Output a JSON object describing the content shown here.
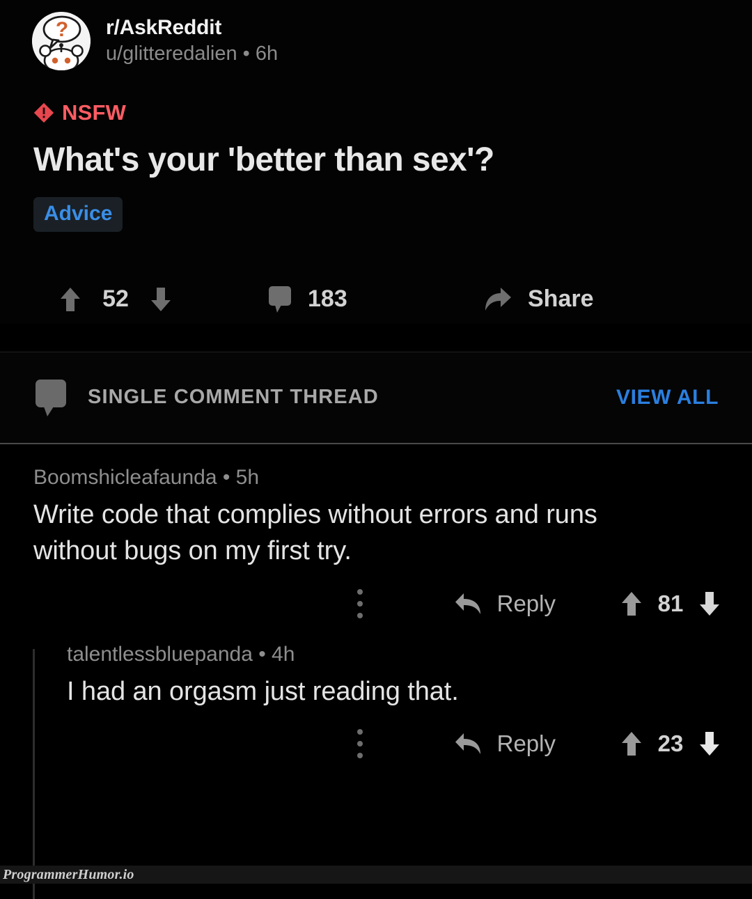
{
  "post": {
    "avatar_icon": "reddit-snoo-question-avatar",
    "subreddit": "r/AskReddit",
    "meta": "u/glitteredalien • 6h",
    "nsfw_icon": "nsfw-warning-diamond-icon",
    "nsfw_label": "NSFW",
    "title": "What's your 'better than sex'?",
    "flair": "Advice",
    "upvote_icon": "upvote-arrow-icon",
    "downvote_icon": "downvote-arrow-icon",
    "score": "52",
    "comment_icon": "comment-bubble-icon",
    "comment_count": "183",
    "share_icon": "share-arrow-icon",
    "share_label": "Share"
  },
  "thread_band": {
    "icon": "comment-bubble-icon",
    "label": "SINGLE COMMENT THREAD",
    "action": "VIEW ALL"
  },
  "comments": [
    {
      "author": "Boomshicleafaunda • 5h",
      "body": "Write code that complies without errors and runs without bugs on my first try.",
      "kebab_icon": "overflow-menu-icon",
      "reply_icon": "reply-arrow-icon",
      "reply_label": "Reply",
      "upvote_icon": "upvote-arrow-icon",
      "downvote_icon": "downvote-arrow-icon",
      "score": "81"
    },
    {
      "author": "talentlessbluepanda • 4h",
      "body": "I had an orgasm just reading that.",
      "kebab_icon": "overflow-menu-icon",
      "reply_icon": "reply-arrow-icon",
      "reply_label": "Reply",
      "upvote_icon": "upvote-arrow-icon",
      "downvote_icon": "downvote-arrow-icon",
      "score": "23"
    }
  ],
  "watermark": "ProgrammerHumor.io",
  "colors": {
    "background": "#000000",
    "nsfw_red": "#ff5c63",
    "link_blue": "#2a7fe0",
    "flair_blue": "#3a8ee6",
    "flair_bg": "#1a2026",
    "icon_gray": "#707070",
    "text_primary": "#e4e4e4",
    "text_muted": "#8e8e8e"
  }
}
